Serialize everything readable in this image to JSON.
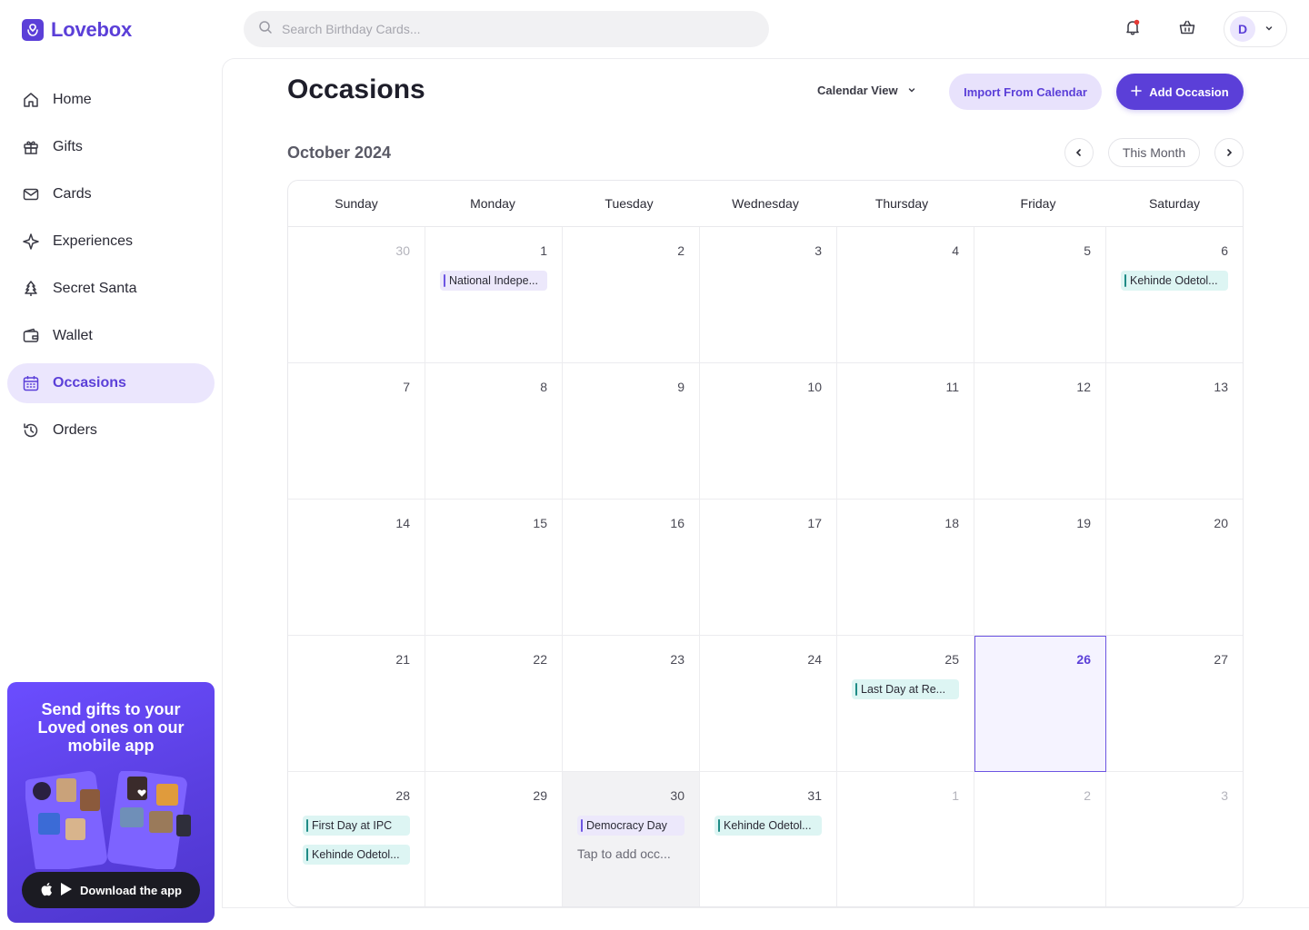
{
  "brand": {
    "name": "Lovebox",
    "color": "#5b3fd8"
  },
  "search": {
    "placeholder": "Search Birthday Cards..."
  },
  "profile": {
    "initial": "D"
  },
  "sidebar": {
    "items": [
      {
        "label": "Home",
        "icon": "home-icon"
      },
      {
        "label": "Gifts",
        "icon": "gift-icon"
      },
      {
        "label": "Cards",
        "icon": "mail-icon"
      },
      {
        "label": "Experiences",
        "icon": "sparkle-icon"
      },
      {
        "label": "Secret Santa",
        "icon": "tree-icon"
      },
      {
        "label": "Wallet",
        "icon": "wallet-icon"
      },
      {
        "label": "Occasions",
        "icon": "calendar-icon",
        "active": true
      },
      {
        "label": "Orders",
        "icon": "history-icon"
      }
    ],
    "promo": {
      "title": "Send gifts to your Loved ones on our mobile app",
      "button": "Download the app"
    }
  },
  "header": {
    "title": "Occasions",
    "view_select": "Calendar View",
    "import_label": "Import From Calendar",
    "add_label": "Add Occasion"
  },
  "calendar": {
    "month_label": "October 2024",
    "this_month_label": "This Month",
    "weekdays": [
      "Sunday",
      "Monday",
      "Tuesday",
      "Wednesday",
      "Thursday",
      "Friday",
      "Saturday"
    ],
    "cells": [
      {
        "day": "30",
        "muted": true,
        "events": []
      },
      {
        "day": "1",
        "events": [
          {
            "label": "National Indepe...",
            "color": "purple"
          }
        ]
      },
      {
        "day": "2",
        "events": []
      },
      {
        "day": "3",
        "events": []
      },
      {
        "day": "4",
        "events": []
      },
      {
        "day": "5",
        "events": []
      },
      {
        "day": "6",
        "events": [
          {
            "label": "Kehinde Odetol...",
            "color": "teal"
          }
        ]
      },
      {
        "day": "7",
        "events": []
      },
      {
        "day": "8",
        "events": []
      },
      {
        "day": "9",
        "events": []
      },
      {
        "day": "10",
        "events": []
      },
      {
        "day": "11",
        "events": []
      },
      {
        "day": "12",
        "events": []
      },
      {
        "day": "13",
        "events": []
      },
      {
        "day": "14",
        "events": []
      },
      {
        "day": "15",
        "events": []
      },
      {
        "day": "16",
        "events": []
      },
      {
        "day": "17",
        "events": []
      },
      {
        "day": "18",
        "events": []
      },
      {
        "day": "19",
        "events": []
      },
      {
        "day": "20",
        "events": []
      },
      {
        "day": "21",
        "events": []
      },
      {
        "day": "22",
        "events": []
      },
      {
        "day": "23",
        "events": []
      },
      {
        "day": "24",
        "events": []
      },
      {
        "day": "25",
        "events": [
          {
            "label": "Last Day at Re...",
            "color": "teal"
          }
        ]
      },
      {
        "day": "26",
        "today": true,
        "events": []
      },
      {
        "day": "27",
        "events": []
      },
      {
        "day": "28",
        "events": [
          {
            "label": "First Day at IPC",
            "color": "teal"
          },
          {
            "label": "Kehinde Odetol...",
            "color": "teal"
          }
        ]
      },
      {
        "day": "29",
        "events": []
      },
      {
        "day": "30",
        "hover": true,
        "events": [
          {
            "label": "Democracy Day",
            "color": "purple"
          }
        ],
        "hint": "Tap to add occ..."
      },
      {
        "day": "31",
        "events": [
          {
            "label": "Kehinde Odetol...",
            "color": "teal"
          }
        ]
      },
      {
        "day": "1",
        "muted": true,
        "events": []
      },
      {
        "day": "2",
        "muted": true,
        "events": []
      },
      {
        "day": "3",
        "muted": true,
        "events": []
      }
    ]
  }
}
